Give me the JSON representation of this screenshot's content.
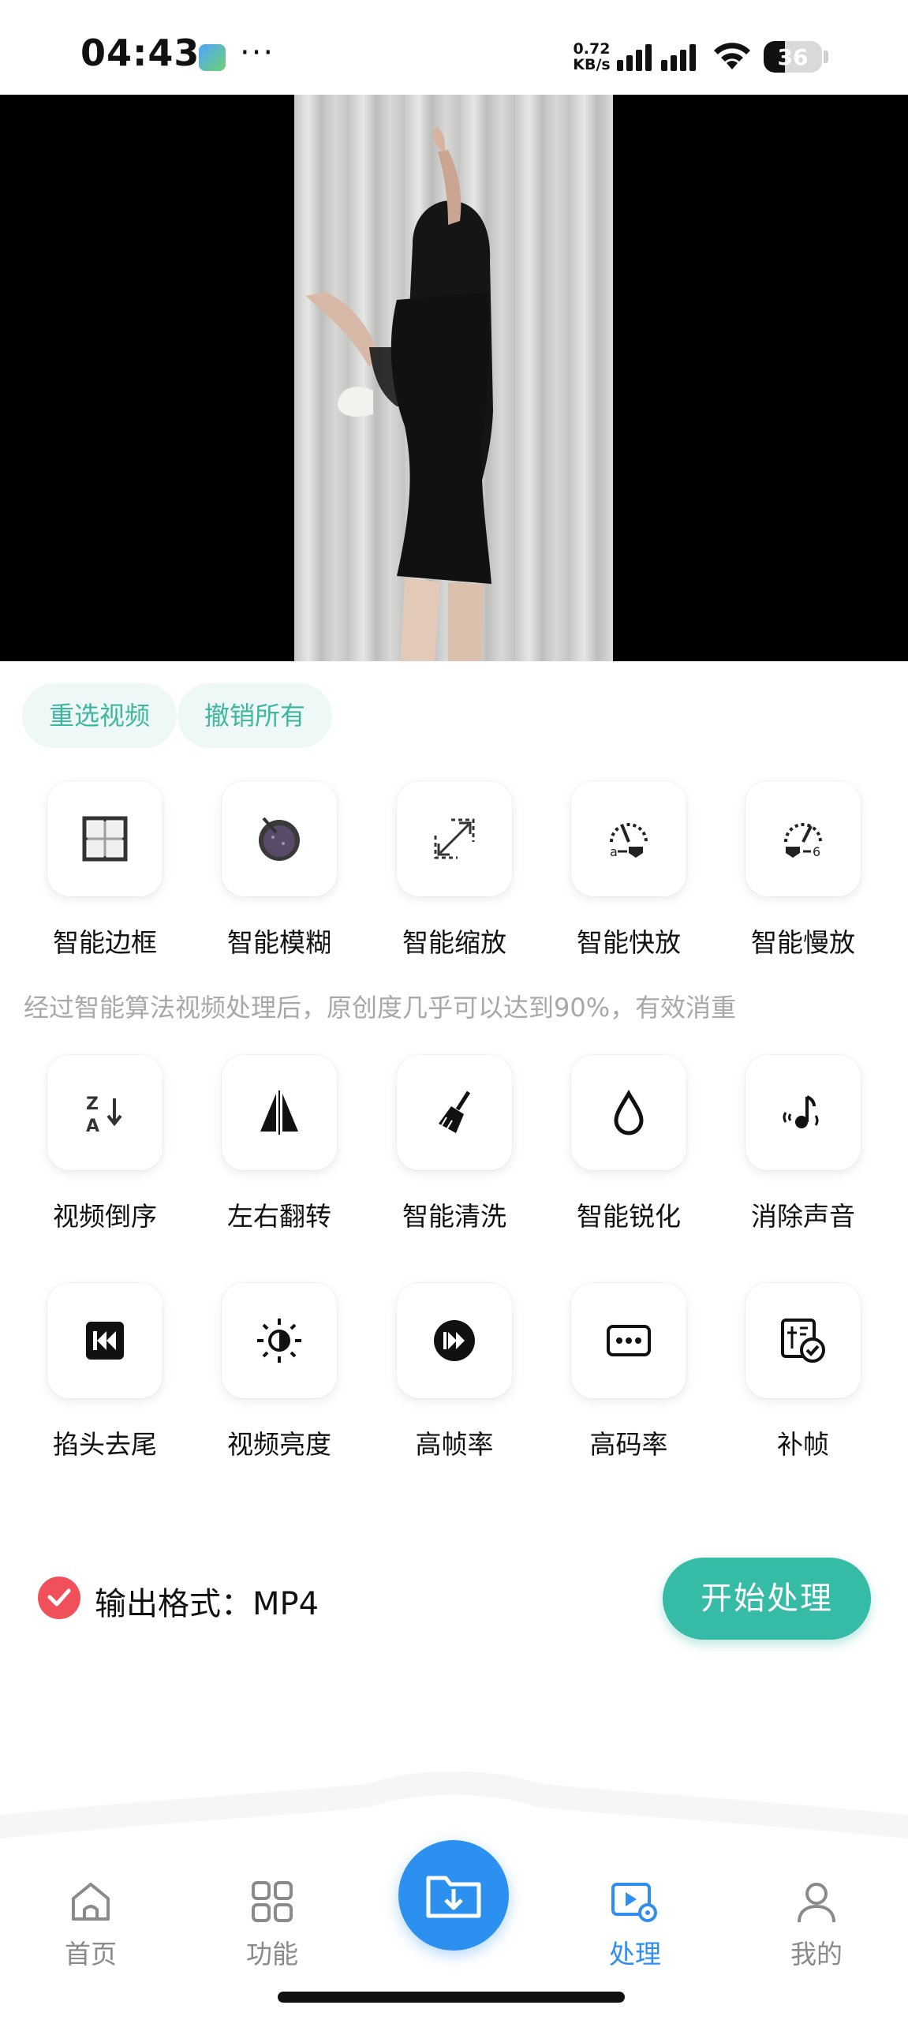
{
  "status_bar": {
    "time": "04:43",
    "more": "···",
    "net_speed_value": "0.72",
    "net_speed_unit": "KB/s",
    "battery": "36",
    "battery_level": 0.36
  },
  "actions": {
    "reselect_video": "重选视频",
    "undo_all": "撤销所有"
  },
  "features_row1": [
    {
      "label": "智能边框",
      "icon": "frame-icon"
    },
    {
      "label": "智能模糊",
      "icon": "blur-icon"
    },
    {
      "label": "智能缩放",
      "icon": "zoom-icon"
    },
    {
      "label": "智能快放",
      "icon": "fast-forward-gauge-icon"
    },
    {
      "label": "智能慢放",
      "icon": "slow-motion-gauge-icon"
    }
  ],
  "description": "经过智能算法视频处理后，原创度几乎可以达到90%，有效消重",
  "features_row2": [
    {
      "label": "视频倒序",
      "icon": "sort-reverse-icon"
    },
    {
      "label": "左右翻转",
      "icon": "flip-horizontal-icon"
    },
    {
      "label": "智能清洗",
      "icon": "broom-icon"
    },
    {
      "label": "智能锐化",
      "icon": "droplet-icon"
    },
    {
      "label": "消除声音",
      "icon": "mute-note-icon"
    }
  ],
  "features_row3": [
    {
      "label": "掐头去尾",
      "icon": "skip-back-icon"
    },
    {
      "label": "视频亮度",
      "icon": "brightness-icon"
    },
    {
      "label": "高帧率",
      "icon": "fast-forward-circle-icon"
    },
    {
      "label": "高码率",
      "icon": "bitrate-icon"
    },
    {
      "label": "补帧",
      "icon": "frame-fill-icon"
    }
  ],
  "output": {
    "format_label": "输出格式：MP4",
    "checked": true
  },
  "start_button": "开始处理",
  "nav": {
    "home": "首页",
    "features": "功能",
    "process": "处理",
    "mine": "我的",
    "active": "process"
  },
  "colors": {
    "accent_teal": "#36bba6",
    "chip_bg": "#eef8f6",
    "nav_active": "#2f8ef0",
    "check_red": "#f0505a"
  }
}
